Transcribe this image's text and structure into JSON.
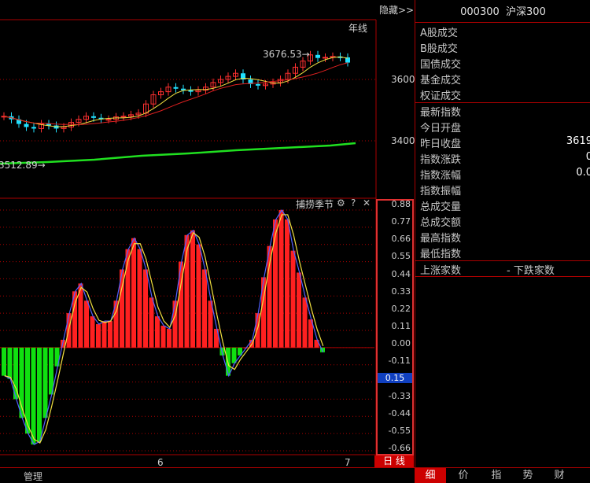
{
  "header": {
    "hide_label": "隐藏>>",
    "code": "000300",
    "name": "沪深300"
  },
  "main_chart": {
    "period_label": "年线",
    "high_annotation": "3676.53→",
    "low_annotation": "3512.89→",
    "price_ticks": [
      "3600",
      "3400"
    ]
  },
  "indicator": {
    "name": "捕捞季节",
    "ticks": [
      "0.88",
      "0.77",
      "0.66",
      "0.55",
      "0.44",
      "0.33",
      "0.22",
      "0.11",
      "0.00",
      "-0.11",
      "0.15",
      "-0.33",
      "-0.44",
      "-0.55",
      "-0.66"
    ],
    "current_value": "0.15",
    "bars": [
      -0.18,
      -0.2,
      -0.33,
      -0.45,
      -0.55,
      -0.62,
      -0.6,
      -0.45,
      -0.3,
      -0.12,
      0.05,
      0.22,
      0.36,
      0.41,
      0.3,
      0.2,
      0.15,
      0.17,
      0.17,
      0.3,
      0.5,
      0.63,
      0.7,
      0.63,
      0.5,
      0.32,
      0.2,
      0.14,
      0.12,
      0.3,
      0.55,
      0.72,
      0.75,
      0.66,
      0.5,
      0.3,
      0.12,
      -0.05,
      -0.18,
      -0.1,
      -0.05,
      0.0,
      0.05,
      0.22,
      0.45,
      0.65,
      0.82,
      0.88,
      0.82,
      0.62,
      0.48,
      0.32,
      0.18,
      0.05,
      -0.03
    ],
    "color_up": "#ff2020",
    "color_down": "#10e010"
  },
  "x_labels": [
    "6",
    "7"
  ],
  "day_button": "日 线",
  "manage_label": "管理",
  "right_panel": {
    "rows": [
      {
        "label": "A股成交",
        "value": ""
      },
      {
        "label": "B股成交",
        "value": ""
      },
      {
        "label": "国债成交",
        "value": ""
      },
      {
        "label": "基金成交",
        "value": ""
      },
      {
        "label": "权证成交",
        "value": ""
      },
      {
        "label": "最新指数",
        "value": ""
      },
      {
        "label": "今日开盘",
        "value": ""
      },
      {
        "label": "昨日收盘",
        "value": "3619"
      },
      {
        "label": "指数涨跌",
        "value": "0"
      },
      {
        "label": "指数涨幅",
        "value": "0.0"
      },
      {
        "label": "指数振幅",
        "value": ""
      },
      {
        "label": "总成交量",
        "value": ""
      },
      {
        "label": "总成交额",
        "value": ""
      },
      {
        "label": "最高指数",
        "value": ""
      },
      {
        "label": "最低指数",
        "value": ""
      }
    ],
    "up_count_label": "上涨家数",
    "down_count_label": "- 下跌家数"
  },
  "bottom_tabs": [
    "细",
    "价",
    "指",
    "势",
    "财"
  ]
}
